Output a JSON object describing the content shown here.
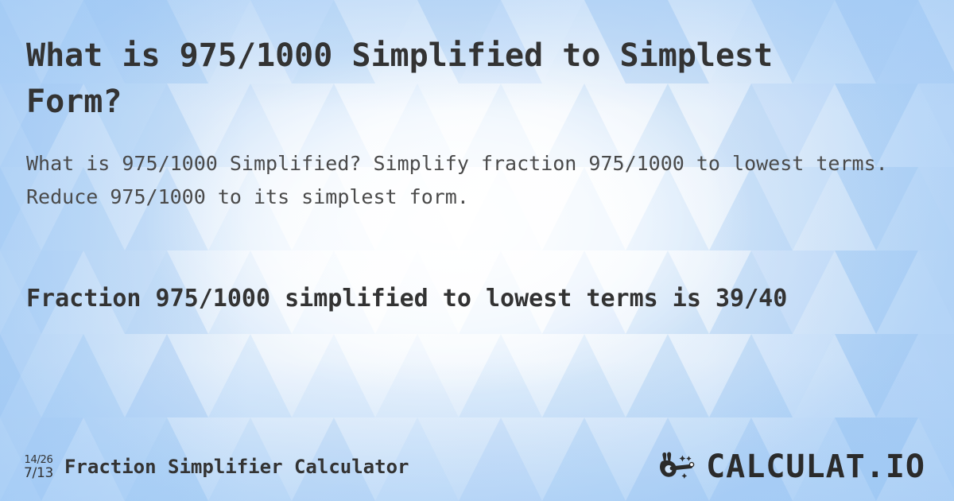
{
  "page": {
    "title": "What is 975/1000 Simplified to Simplest Form?",
    "description": "What is 975/1000 Simplified? Simplify fraction 975/1000 to lowest terms. Reduce 975/1000 to its simplest form.",
    "answer": "Fraction 975/1000 simplified to lowest terms is 39/40"
  },
  "fraction": {
    "numerator": "975",
    "denominator": "1000",
    "original": "975/1000",
    "simplified": "39/40",
    "simplified_numerator": "39",
    "simplified_denominator": "40"
  },
  "footer": {
    "icon": {
      "name": "fraction-simplify-icon",
      "top": "14/26",
      "bottom": "7/13"
    },
    "label": "Fraction Simplifier Calculator",
    "logo": {
      "icon_name": "hand-magic-wand-icon",
      "text": "CALCULAT.IO"
    }
  },
  "colors": {
    "background_light": "#eef6fd",
    "background_blue": "#aacef6",
    "text_dark": "#333333",
    "text_muted": "#4a4a4a",
    "logo_dark": "#2b2b2b"
  }
}
